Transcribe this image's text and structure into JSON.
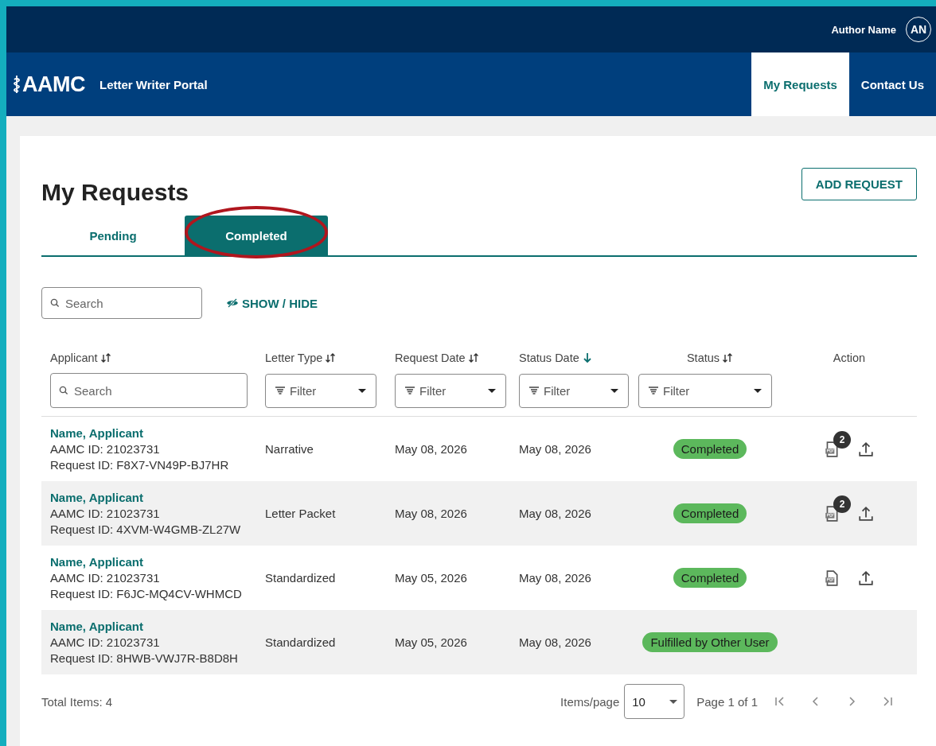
{
  "header": {
    "user_name": "Author Name",
    "avatar_initials": "AN"
  },
  "nav": {
    "logo": "AAMC",
    "portal_title": "Letter Writer Portal",
    "links": [
      {
        "label": "My Requests",
        "selected": true
      },
      {
        "label": "Contact Us",
        "selected": false
      }
    ]
  },
  "page": {
    "title": "My Requests",
    "add_button": "ADD REQUEST"
  },
  "tabs": [
    {
      "label": "Pending",
      "selected": false,
      "circled": false
    },
    {
      "label": "Completed",
      "selected": true,
      "circled": true
    }
  ],
  "toolbar": {
    "search_placeholder": "Search",
    "show_hide": "SHOW / HIDE"
  },
  "table": {
    "columns": [
      {
        "label": "Applicant",
        "kind": "search",
        "sortable": true,
        "sorted": false,
        "placeholder": "Search"
      },
      {
        "label": "Letter Type",
        "kind": "dropdown",
        "sortable": true,
        "sorted": false,
        "placeholder": "Filter"
      },
      {
        "label": "Request Date",
        "kind": "dropdown",
        "sortable": true,
        "sorted": false,
        "placeholder": "Filter"
      },
      {
        "label": "Status Date",
        "kind": "dropdown",
        "sortable": true,
        "sorted": true,
        "placeholder": "Filter"
      },
      {
        "label": "Status",
        "kind": "dropdown",
        "sortable": true,
        "sorted": false,
        "placeholder": "Filter"
      },
      {
        "label": "Action",
        "kind": "plain",
        "sortable": false,
        "sorted": false
      }
    ],
    "rows": [
      {
        "name": "Name, Applicant",
        "aamc_id": "AAMC ID: 21023731",
        "request_id": "Request ID: F8X7-VN49P-BJ7HR",
        "letter_type": "Narrative",
        "request_date": "May 08, 2026",
        "status_date": "May 08, 2026",
        "status": "Completed",
        "actions": {
          "document_count": "2",
          "upload": true
        }
      },
      {
        "name": "Name, Applicant",
        "aamc_id": "AAMC ID: 21023731",
        "request_id": "Request ID: 4XVM-W4GMB-ZL27W",
        "letter_type": "Letter Packet",
        "request_date": "May 08, 2026",
        "status_date": "May 08, 2026",
        "status": "Completed",
        "actions": {
          "document_count": "2",
          "upload": true
        }
      },
      {
        "name": "Name, Applicant",
        "aamc_id": "AAMC ID: 21023731",
        "request_id": "Request ID: F6JC-MQ4CV-WHMCD",
        "letter_type": "Standardized",
        "request_date": "May 05, 2026",
        "status_date": "May 08, 2026",
        "status": "Completed",
        "actions": {
          "upload": true
        }
      },
      {
        "name": "Name, Applicant",
        "aamc_id": "AAMC ID: 21023731",
        "request_id": "Request ID: 8HWB-VWJ7R-B8D8H",
        "letter_type": "Standardized",
        "request_date": "May 05, 2026",
        "status_date": "May 08, 2026",
        "status": "Fulfilled by Other User"
      }
    ]
  },
  "footer": {
    "total": "Total Items: 4",
    "items_per_page_label": "Items/page",
    "items_per_page": "10",
    "page_info": "Page 1 of 1"
  }
}
